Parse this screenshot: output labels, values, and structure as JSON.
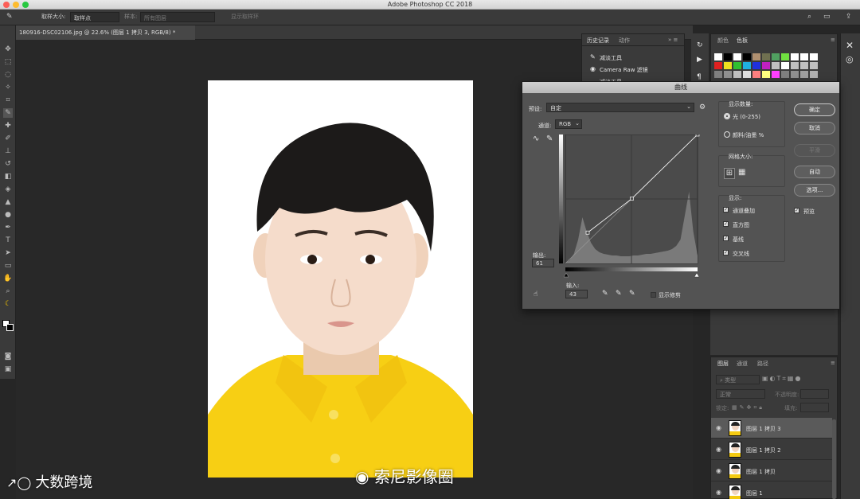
{
  "app": {
    "title": "Adobe Photoshop CC 2018"
  },
  "options_bar": {
    "sample_size_label": "取样大小:",
    "sample_size_value": "取样点",
    "sample_label": "样本:",
    "sample_value": "所有图层",
    "show_ring_label": "显示取样环"
  },
  "document": {
    "tab_title": "180916-DSC02106.jpg @ 22.6% (图层 1 拷贝 3, RGB/8) *"
  },
  "history_panel": {
    "tabs": [
      "历史记录",
      "动作"
    ],
    "items": [
      "减淡工具",
      "Camera Raw 滤镜",
      "减淡工具"
    ]
  },
  "color_panel": {
    "tabs": [
      "颜色",
      "色板"
    ],
    "swatch_colors": [
      "#ffffff",
      "#000000",
      "#ffffff",
      "#000000",
      "#b09070",
      "#707050",
      "#50a060",
      "#70e040",
      "#ffffff",
      "#ffffff",
      "#ffffff",
      "#e02020",
      "#f0e020",
      "#30c030",
      "#20b0e0",
      "#2030e0",
      "#c020c0",
      "#c0c0c0",
      "#ffffff",
      "#c0c0c0",
      "#c0c0c0",
      "#c0c0c0",
      "#808080",
      "#909090",
      "#c0c0c0",
      "#e0e0e0",
      "#ff8080",
      "#ffff80",
      "#ff40ff",
      "#808080",
      "#909090",
      "#a0a0a0",
      "#b0b0b0"
    ]
  },
  "curves": {
    "title": "曲线",
    "preset_label": "预设:",
    "preset_value": "自定",
    "channel_label": "通道:",
    "channel_value": "RGB",
    "output_label": "输出:",
    "output_value": "61",
    "input_label": "输入:",
    "input_value": "43",
    "show_clipping_label": "显示修剪",
    "show_amount_label": "显示数量:",
    "light_option": "光 (0-255)",
    "pigment_option": "颜料/油墨 %",
    "grid_size_label": "网格大小:",
    "show_label": "显示:",
    "show_options": [
      "通道叠加",
      "直方图",
      "基线",
      "交叉线"
    ],
    "buttons": {
      "ok": "确定",
      "cancel": "取消",
      "smooth": "平滑",
      "auto": "自动",
      "options": "选项..."
    },
    "preview_label": "预览",
    "curve_points": [
      [
        43,
        61
      ],
      [
        128,
        128
      ],
      [
        255,
        255
      ]
    ]
  },
  "layers_panel": {
    "tabs": [
      "图层",
      "通道",
      "路径"
    ],
    "kind_label": "类型",
    "blend_mode": "正常",
    "opacity_label": "不透明度:",
    "lock_label": "锁定:",
    "fill_label": "填充:",
    "layers": [
      "图层 1 拷贝 3",
      "图层 1 拷贝 2",
      "图层 1 拷贝",
      "图层 1"
    ]
  },
  "watermarks": {
    "left": "大数跨境",
    "center": "索尼影像圈"
  }
}
